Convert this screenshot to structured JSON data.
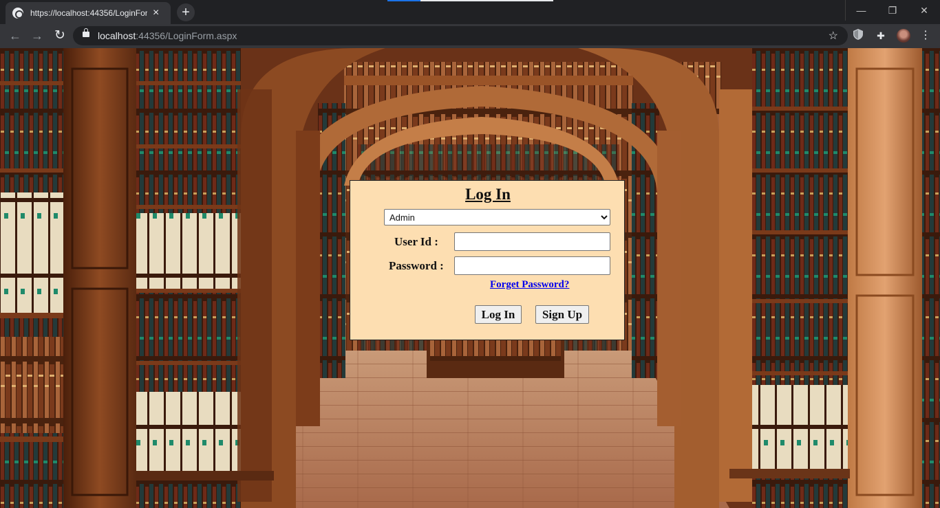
{
  "browser": {
    "tab_title": "https://localhost:44356/LoginForm.aspx",
    "tab_close": "×",
    "new_tab": "+",
    "url_host": "localhost",
    "url_rest": ":44356/LoginForm.aspx",
    "controls": {
      "minimize": "—",
      "maximize": "❐",
      "close": "✕"
    },
    "nav": {
      "back": "←",
      "forward": "→",
      "reload": "↻"
    },
    "star": "☆",
    "menu": "⋮",
    "puzzle": "✚"
  },
  "login": {
    "title": "Log In",
    "role_selected": "Admin",
    "user_id_label": "User Id :",
    "user_id_value": "",
    "password_label": "Password :",
    "password_value": "",
    "forget_password": "Forget Password?",
    "login_button": "Log In",
    "signup_button": "Sign Up"
  },
  "colors": {
    "form_bg": "#fddeb1",
    "link": "#0000ee",
    "wood_dark": "#5b2a10",
    "wood_mid": "#9a5a2e",
    "wood_light": "#d79a66"
  },
  "icons": [
    "site-favicon",
    "lock-icon",
    "star-icon",
    "shield-icon",
    "puzzle-icon",
    "profile-avatar",
    "menu-icon"
  ]
}
